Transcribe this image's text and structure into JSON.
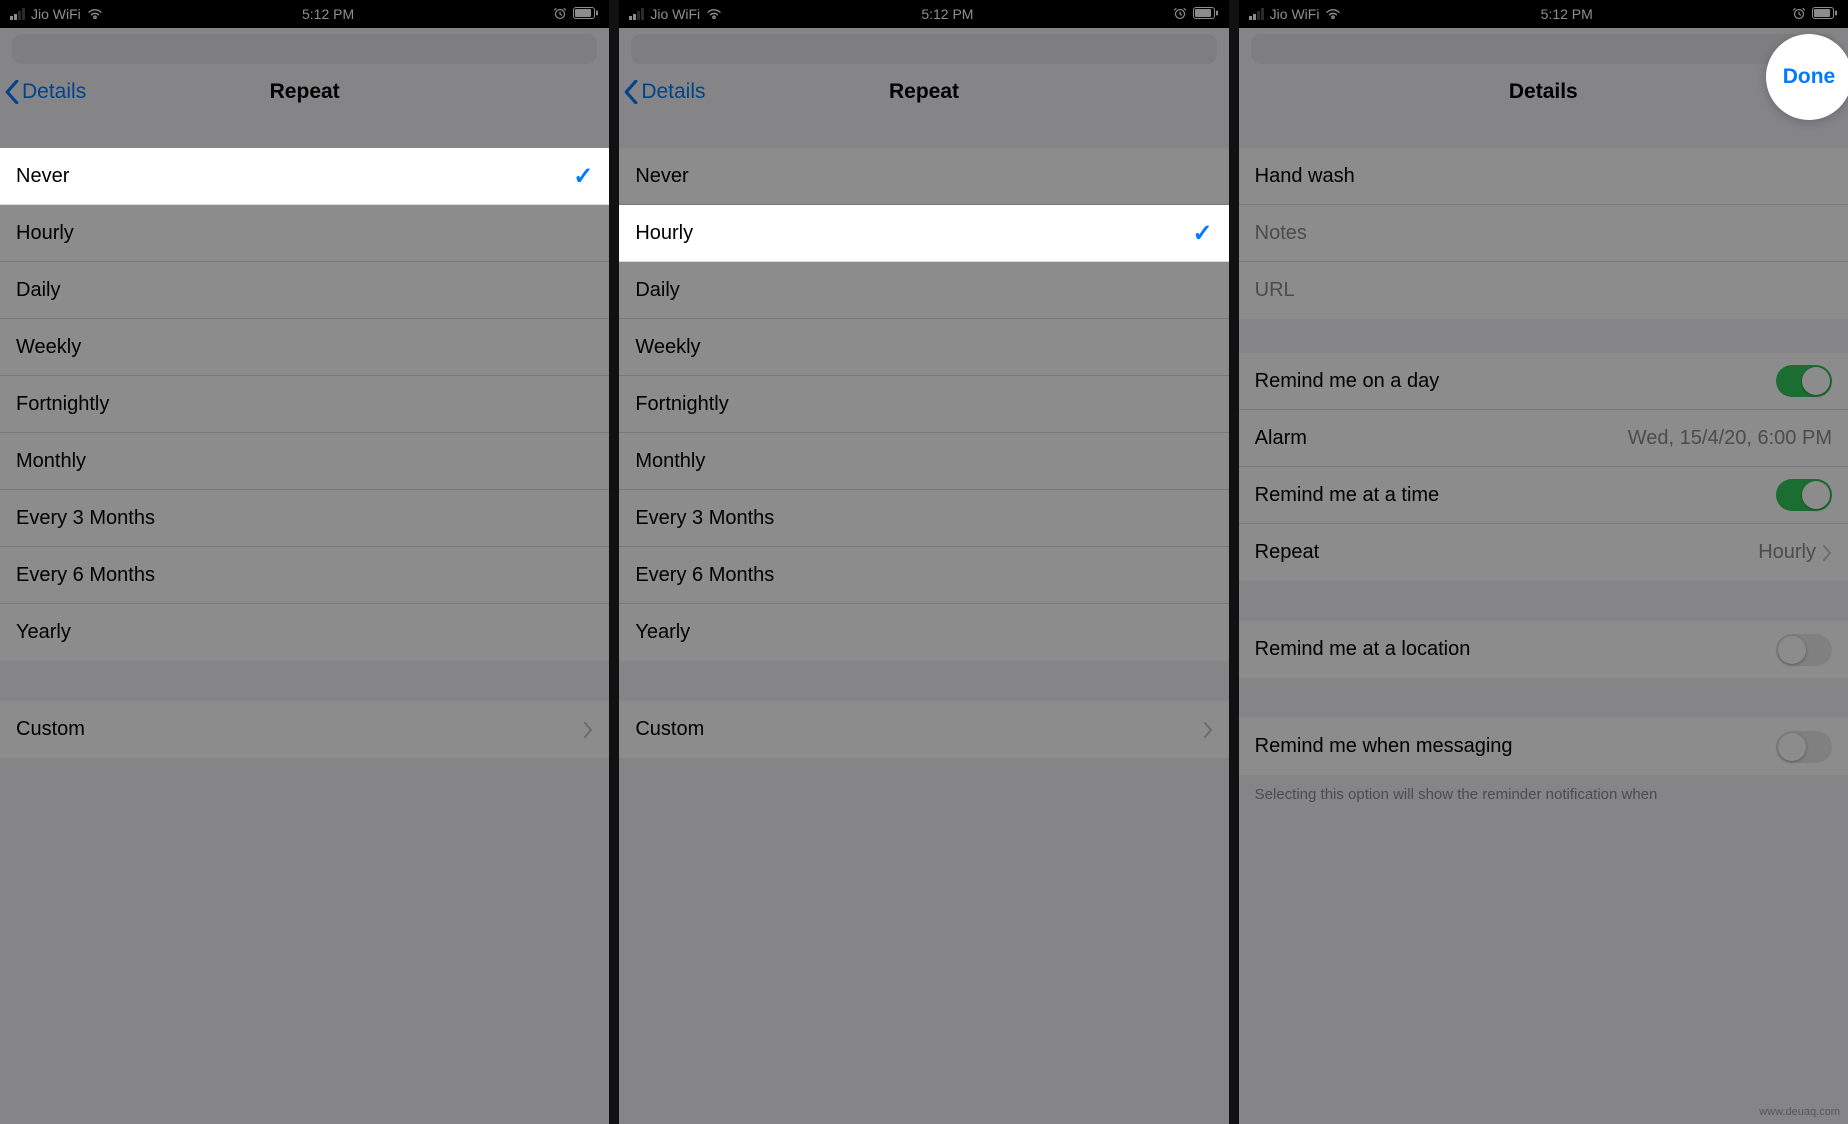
{
  "status": {
    "carrier": "Jio WiFi",
    "time": "5:12 PM"
  },
  "panel1": {
    "back": "Details",
    "title": "Repeat",
    "options": [
      "Never",
      "Hourly",
      "Daily",
      "Weekly",
      "Fortnightly",
      "Monthly",
      "Every 3 Months",
      "Every 6 Months",
      "Yearly"
    ],
    "selected_index": 0,
    "custom": "Custom"
  },
  "panel2": {
    "back": "Details",
    "title": "Repeat",
    "options": [
      "Never",
      "Hourly",
      "Daily",
      "Weekly",
      "Fortnightly",
      "Monthly",
      "Every 3 Months",
      "Every 6 Months",
      "Yearly"
    ],
    "selected_index": 1,
    "custom": "Custom"
  },
  "panel3": {
    "title": "Details",
    "done": "Done",
    "reminder_title": "Hand wash",
    "notes_placeholder": "Notes",
    "url_placeholder": "URL",
    "rows": {
      "remind_day": {
        "label": "Remind me on a day",
        "on": true
      },
      "alarm": {
        "label": "Alarm",
        "value": "Wed, 15/4/20, 6:00 PM"
      },
      "remind_time": {
        "label": "Remind me at a time",
        "on": true
      },
      "repeat": {
        "label": "Repeat",
        "value": "Hourly"
      },
      "remind_location": {
        "label": "Remind me at a location",
        "on": false
      },
      "remind_messaging": {
        "label": "Remind me when messaging",
        "on": false
      }
    },
    "footer": "Selecting this option will show the reminder notification when"
  },
  "watermark": "www.deuaq.com"
}
